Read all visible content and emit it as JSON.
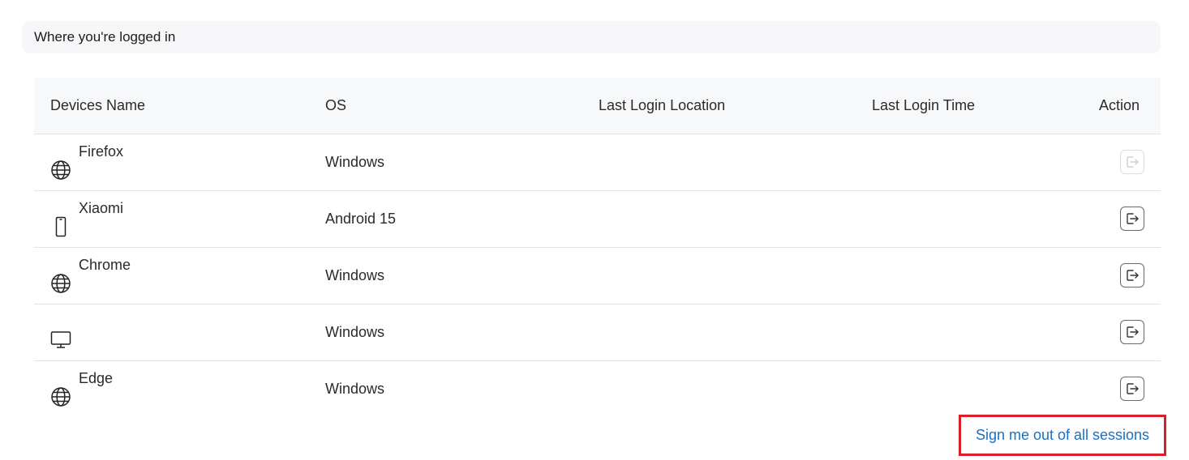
{
  "section": {
    "title": "Where you're logged in"
  },
  "table": {
    "headers": {
      "device": "Devices Name",
      "os": "OS",
      "location": "Last Login Location",
      "time": "Last Login Time",
      "action": "Action"
    },
    "rows": [
      {
        "device_name": "Firefox",
        "device_icon": "globe-icon",
        "os": "Windows",
        "location": "",
        "time": "",
        "action_enabled": false
      },
      {
        "device_name": "Xiaomi",
        "device_icon": "phone-icon",
        "os": "Android 15",
        "location": "",
        "time": "",
        "action_enabled": true
      },
      {
        "device_name": "Chrome",
        "device_icon": "globe-icon",
        "os": "Windows",
        "location": "",
        "time": "",
        "action_enabled": true
      },
      {
        "device_name": "",
        "device_icon": "monitor-icon",
        "os": "Windows",
        "location": "",
        "time": "",
        "action_enabled": true
      },
      {
        "device_name": "Edge",
        "device_icon": "globe-icon",
        "os": "Windows",
        "location": "",
        "time": "",
        "action_enabled": true
      }
    ]
  },
  "footer": {
    "sign_out_all_label": "Sign me out of all sessions"
  },
  "colors": {
    "link": "#1a6fc4",
    "highlight_border": "#d9202a",
    "header_bg": "#f7f7f9"
  }
}
